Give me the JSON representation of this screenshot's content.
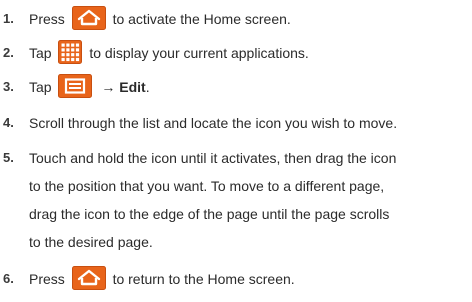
{
  "steps": [
    {
      "number": "1.",
      "before": "Press",
      "icon": "home-key-icon",
      "after": "to activate the Home screen."
    },
    {
      "number": "2.",
      "before": "Tap",
      "icon": "apps-grid-icon",
      "after": "to display your current applications."
    },
    {
      "number": "3.",
      "before": "Tap",
      "icon": "menu-key-icon",
      "arrow": "→",
      "after": "Edit",
      "period": "."
    },
    {
      "number": "4.",
      "text": "Scroll through the list and locate the icon you wish to move."
    },
    {
      "number": "5.",
      "lines": [
        "Touch and hold the icon until it activates, then drag the icon",
        "to the position that you want. To move to a different page,",
        "drag the icon to the edge of the page until the page scrolls",
        "to the desired page."
      ]
    },
    {
      "number": "6.",
      "before": "Press",
      "icon": "home-key-icon",
      "after": "to return to the Home screen."
    }
  ],
  "colors": {
    "text": "#2b2b2b",
    "icon_orange": "#e8641a",
    "icon_orange_dark": "#c84f10"
  }
}
